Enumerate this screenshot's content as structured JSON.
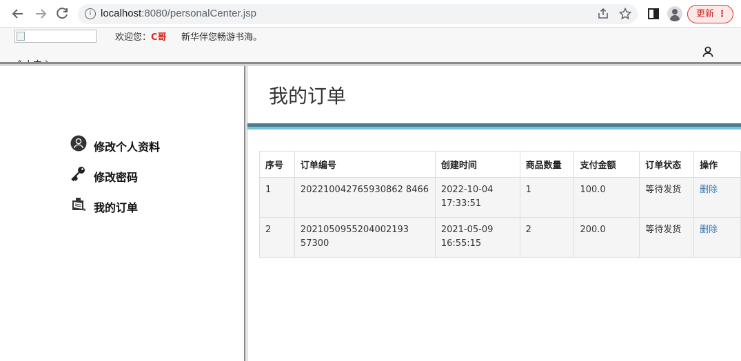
{
  "browser": {
    "url_host": "localhost",
    "url_rest": ":8080/personalCenter.jsp",
    "update_label": "更新",
    "update_dots": "⋮",
    "back_icon": "arrow-left-icon",
    "forward_icon": "arrow-right-icon",
    "reload_icon": "reload-icon",
    "info_icon": "info-icon"
  },
  "header": {
    "welcome_prefix": "欢迎您：",
    "username": "C哥",
    "slogan": "新华伴您畅游书海。",
    "crumb_cut": "个人中心"
  },
  "sidebar": {
    "items": [
      {
        "label": "修改个人资料",
        "icon": "user-circle-icon"
      },
      {
        "label": "修改密码",
        "icon": "key-icon"
      },
      {
        "label": "我的订单",
        "icon": "order-clipboard-icon"
      }
    ]
  },
  "main": {
    "title": "我的订单",
    "table": {
      "headers": [
        "序号",
        "订单编号",
        "创建时间",
        "商品数量",
        "支付金额",
        "订单状态",
        "操作"
      ],
      "rows": [
        {
          "index": "1",
          "order_no": "202210042765930862 8466",
          "created_date": "2022-10-04",
          "created_time": "17:33:51",
          "qty": "1",
          "amount": "100.0",
          "status": "等待发货",
          "action": "删除"
        },
        {
          "index": "2",
          "order_no": "2021050955204002193 57300",
          "created_date": "2021-05-09",
          "created_time": "16:55:15",
          "qty": "2",
          "amount": "200.0",
          "status": "等待发货",
          "action": "删除"
        }
      ]
    }
  },
  "colors": {
    "accent_dark": "#4b7f8f",
    "accent_light": "#7dc1dc",
    "link": "#337ab7",
    "username": "#d9241c"
  }
}
